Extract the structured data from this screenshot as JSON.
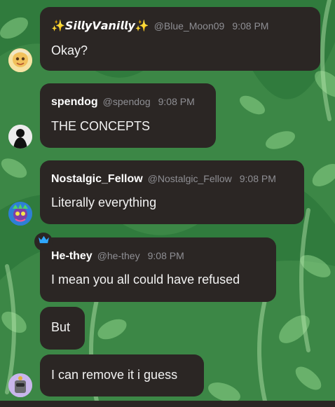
{
  "messages": [
    {
      "name": "✨𝙎𝙞𝙡𝙡𝙮𝙑𝙖𝙣𝙞𝙡𝙡𝙮✨",
      "handle": "@Blue_Moon09",
      "time": "9:08 PM",
      "text": "Okay?"
    },
    {
      "name": "spendog",
      "handle": "@spendog",
      "time": "9:08 PM",
      "text": "THE CONCEPTS"
    },
    {
      "name": "Nostalgic_Fellow",
      "handle": "@Nostalgic_Fellow",
      "time": "9:08 PM",
      "text": "Literally everything"
    },
    {
      "name": "He-they",
      "handle": "@he-they",
      "time": "9:08 PM",
      "text": "I mean you all could have refused"
    },
    {
      "text": "But"
    },
    {
      "text": "I can remove it i guess"
    }
  ],
  "colors": {
    "bubble": "#2b2624",
    "handle_gray": "#8f8f94",
    "crown_blue": "#2fa8ff",
    "background_green": "#3f8a4a"
  },
  "icons": {
    "crown": "crown-icon"
  }
}
